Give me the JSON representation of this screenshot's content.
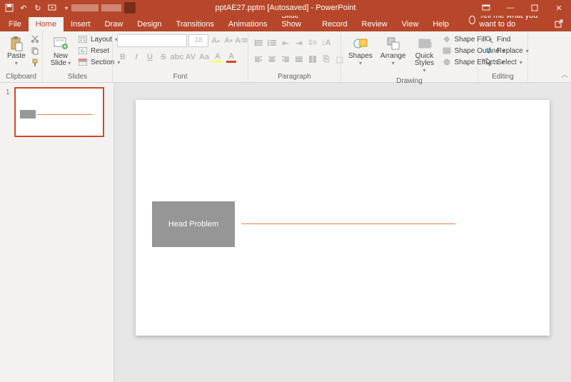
{
  "title": "pptAE27.pptm [Autosaved] - PowerPoint",
  "tabs": {
    "file": "File",
    "home": "Home",
    "insert": "Insert",
    "draw": "Draw",
    "design": "Design",
    "transitions": "Transitions",
    "animations": "Animations",
    "slideshow": "Slide Show",
    "record": "Record",
    "review": "Review",
    "view": "View",
    "help": "Help"
  },
  "tellme": "Tell me what you want to do",
  "share": "Share",
  "ribbon": {
    "clipboard": {
      "paste": "Paste",
      "cut": "Cut",
      "copy": "Copy",
      "formatpainter": "Format Painter",
      "label": "Clipboard"
    },
    "slides": {
      "newslide": "New Slide",
      "layout": "Layout",
      "reset": "Reset",
      "section": "Section",
      "label": "Slides"
    },
    "font": {
      "fontname": "",
      "fontsize": "18",
      "label": "Font"
    },
    "paragraph": {
      "label": "Paragraph"
    },
    "drawing": {
      "shapes": "Shapes",
      "arrange": "Arrange",
      "quickstyles": "Quick Styles",
      "shapefill": "Shape Fill",
      "shapeoutline": "Shape Outline",
      "shapeeffects": "Shape Effects",
      "label": "Drawing"
    },
    "editing": {
      "find": "Find",
      "replace": "Replace",
      "select": "Select",
      "label": "Editing"
    }
  },
  "thumb": {
    "index": "1"
  },
  "slide": {
    "title": "Head Problem"
  }
}
